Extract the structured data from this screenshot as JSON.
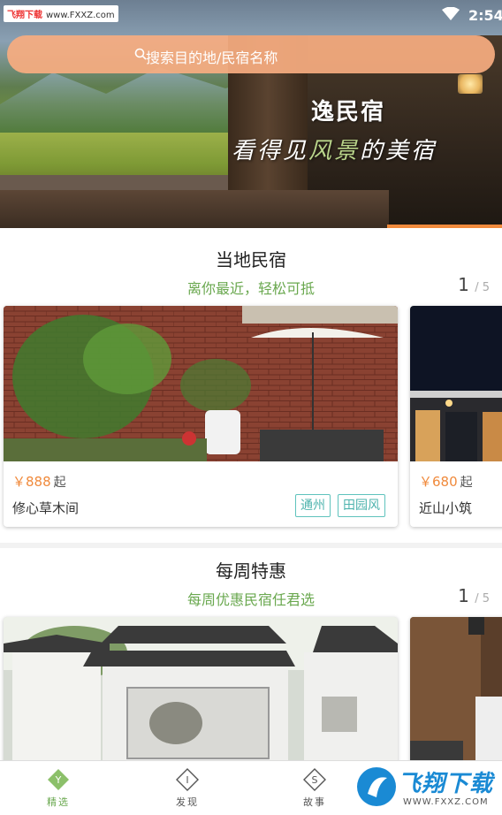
{
  "status_bar": {
    "watermark_site": "飞翔下载",
    "watermark_url": "www.FXXZ.com",
    "time": "2:54"
  },
  "hero": {
    "brand": "逸民宿",
    "slogan_part1": "看得见",
    "slogan_highlight": "风景",
    "slogan_part2": "的美宿"
  },
  "search": {
    "placeholder": "搜索目的地/民宿名称"
  },
  "sections": [
    {
      "title": "当地民宿",
      "subtitle": "离你最近，轻松可抵",
      "page": "1",
      "total": "/ 5",
      "cards": [
        {
          "price_symbol": "￥",
          "price": "888",
          "price_unit": "起",
          "name": "修心草木间",
          "tags": [
            "通州",
            "田园风"
          ]
        },
        {
          "price_symbol": "￥",
          "price": "680",
          "price_unit": "起",
          "name": "近山小筑",
          "tags": []
        }
      ]
    },
    {
      "title": "每周特惠",
      "subtitle": "每周优惠民宿任君选",
      "page": "1",
      "total": "/ 5",
      "cards": []
    }
  ],
  "tabbar": {
    "tabs": [
      {
        "label": "精选",
        "glyph": "Y",
        "active": true
      },
      {
        "label": "发现",
        "glyph": "I",
        "active": false
      },
      {
        "label": "故事",
        "glyph": "S",
        "active": false
      }
    ],
    "logo_text": "飞翔下载",
    "logo_url": "WWW.FXXZ.COM"
  },
  "colors": {
    "accent": "#f08a3c",
    "green": "#6aa84f",
    "teal": "#4db3ad"
  }
}
